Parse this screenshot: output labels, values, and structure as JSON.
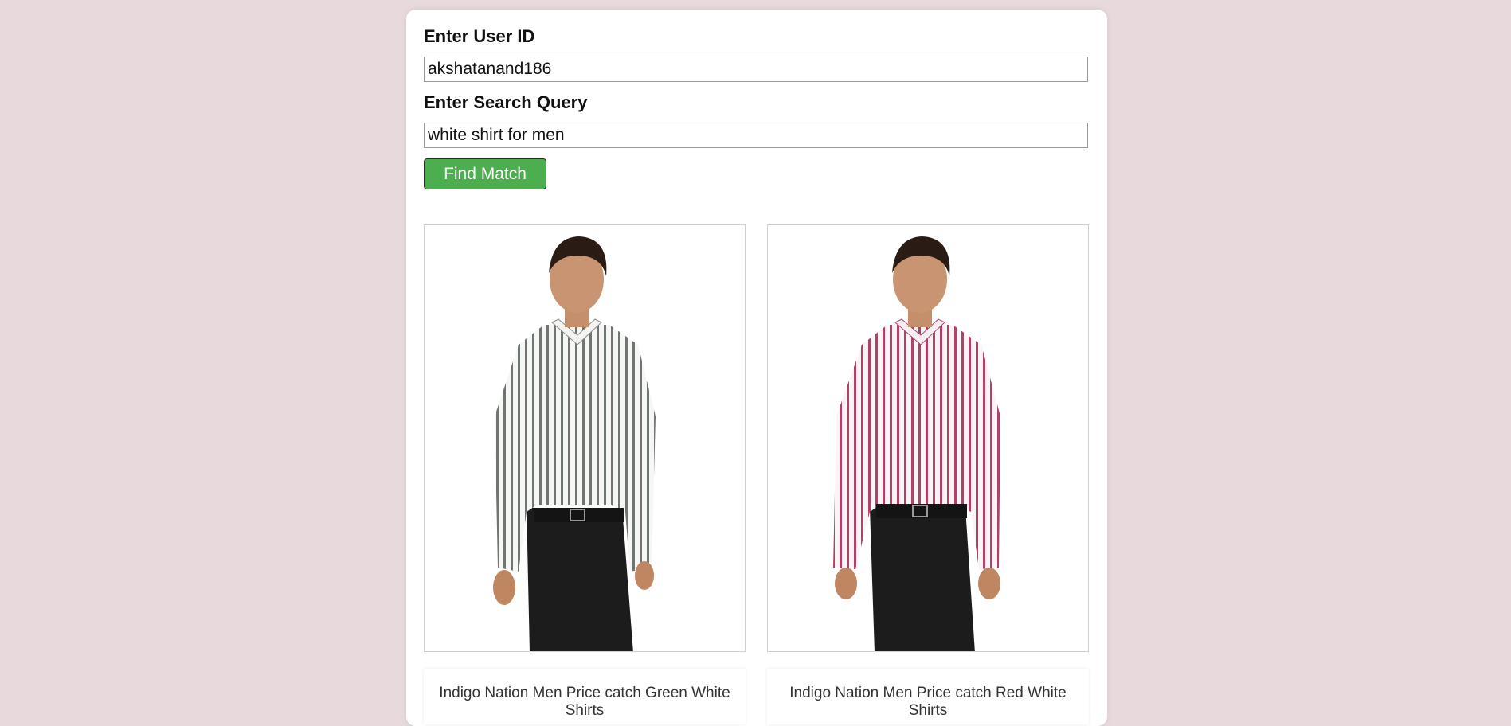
{
  "form": {
    "user_id_label": "Enter User ID",
    "user_id_value": "akshatanand186",
    "query_label": "Enter Search Query",
    "query_value": "white shirt for men",
    "button_label": "Find Match"
  },
  "results": [
    {
      "title": "Indigo Nation Men Price catch Green White Shirts",
      "stripe_color": "#6f7570",
      "image_icon": "striped-shirt-model-image"
    },
    {
      "title": "Indigo Nation Men Price catch Red White Shirts",
      "stripe_color": "#b0426a",
      "image_icon": "striped-shirt-model-image"
    }
  ],
  "colors": {
    "background": "#e8dadc",
    "panel": "#ffffff",
    "button": "#4cae4f"
  }
}
